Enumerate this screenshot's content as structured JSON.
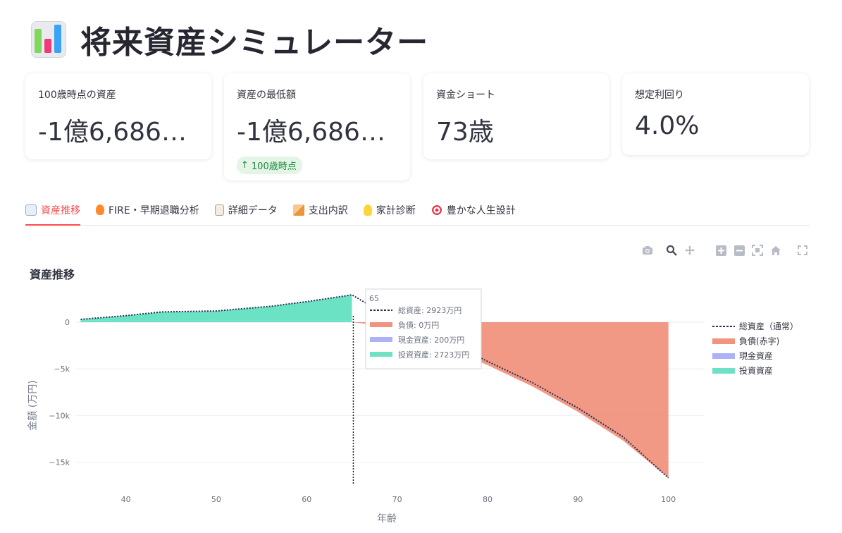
{
  "title": {
    "text": "将来資産シミュレーター",
    "icon": "bar-chart-icon"
  },
  "metrics": [
    {
      "label": "100歳時点の資産",
      "value": "-1億6,686…"
    },
    {
      "label": "資産の最低額",
      "value": "-1億6,686…",
      "delta": "100歳時点"
    },
    {
      "label": "資金ショート",
      "value": "73歳"
    },
    {
      "label": "想定利回り",
      "value": "4.0%"
    }
  ],
  "tabs": [
    {
      "label": "資産推移",
      "icon": "chart-up-icon",
      "active": true
    },
    {
      "label": "FIRE・早期退職分析",
      "icon": "fire-icon"
    },
    {
      "label": "詳細データ",
      "icon": "clipboard-icon"
    },
    {
      "label": "支出内訳",
      "icon": "cake-icon"
    },
    {
      "label": "家計診断",
      "icon": "lightbulb-icon"
    },
    {
      "label": "豊かな人生設計",
      "icon": "target-icon"
    }
  ],
  "modebar": [
    "camera-icon",
    "zoom-icon",
    "pan-icon",
    "zoom-in-icon",
    "zoom-out-icon",
    "autoscale-icon",
    "reset-axes-icon",
    "fullscreen-icon"
  ],
  "colors": {
    "accent": "#ff4b4b",
    "liability": "#f08770",
    "cash": "#a4aaf5",
    "invest": "#5fdfbf",
    "total": "#2a3150"
  },
  "chart_data": {
    "type": "area",
    "title": "資産推移",
    "xlabel": "年齢",
    "ylabel": "金額 (万円)",
    "xlim": [
      34.5,
      104
    ],
    "ylim": [
      -17600,
      4000
    ],
    "xticks": [
      40,
      50,
      60,
      70,
      80,
      90,
      100
    ],
    "yticks": [
      0,
      -5000,
      -10000,
      -15000
    ],
    "ytick_labels": [
      "0",
      "−5k",
      "−10k",
      "−15k"
    ],
    "legend_position": "right",
    "grid": true,
    "x": [
      35,
      40,
      44,
      50,
      56,
      60,
      65,
      70,
      75,
      80,
      85,
      90,
      95,
      100
    ],
    "series": [
      {
        "name": "総資産（通常）",
        "style": "dotted",
        "values": [
          300,
          700,
          1100,
          1200,
          1700,
          2200,
          2923,
          100,
          -1800,
          -4200,
          -6500,
          -9200,
          -12300,
          -16686
        ]
      },
      {
        "name": "負債(赤字)",
        "values": [
          0,
          0,
          0,
          0,
          0,
          0,
          0,
          -600,
          -2500,
          -4600,
          -6900,
          -9600,
          -12700,
          -16686
        ]
      },
      {
        "name": "現金資産",
        "values": [
          150,
          200,
          200,
          200,
          200,
          200,
          200,
          200,
          0,
          0,
          0,
          0,
          0,
          0
        ]
      },
      {
        "name": "投資資産",
        "values": [
          150,
          500,
          900,
          1000,
          1500,
          2000,
          2723,
          0,
          0,
          0,
          0,
          0,
          0,
          0
        ]
      }
    ],
    "hover": {
      "x_label": "65",
      "lines": [
        {
          "series": "総資産（通常）",
          "text": "総資産: 2923万円"
        },
        {
          "series": "負債(赤字)",
          "text": "負債: 0万円"
        },
        {
          "series": "現金資産",
          "text": "現金資産: 200万円"
        },
        {
          "series": "投資資産",
          "text": "投資資産: 2723万円"
        }
      ]
    }
  }
}
